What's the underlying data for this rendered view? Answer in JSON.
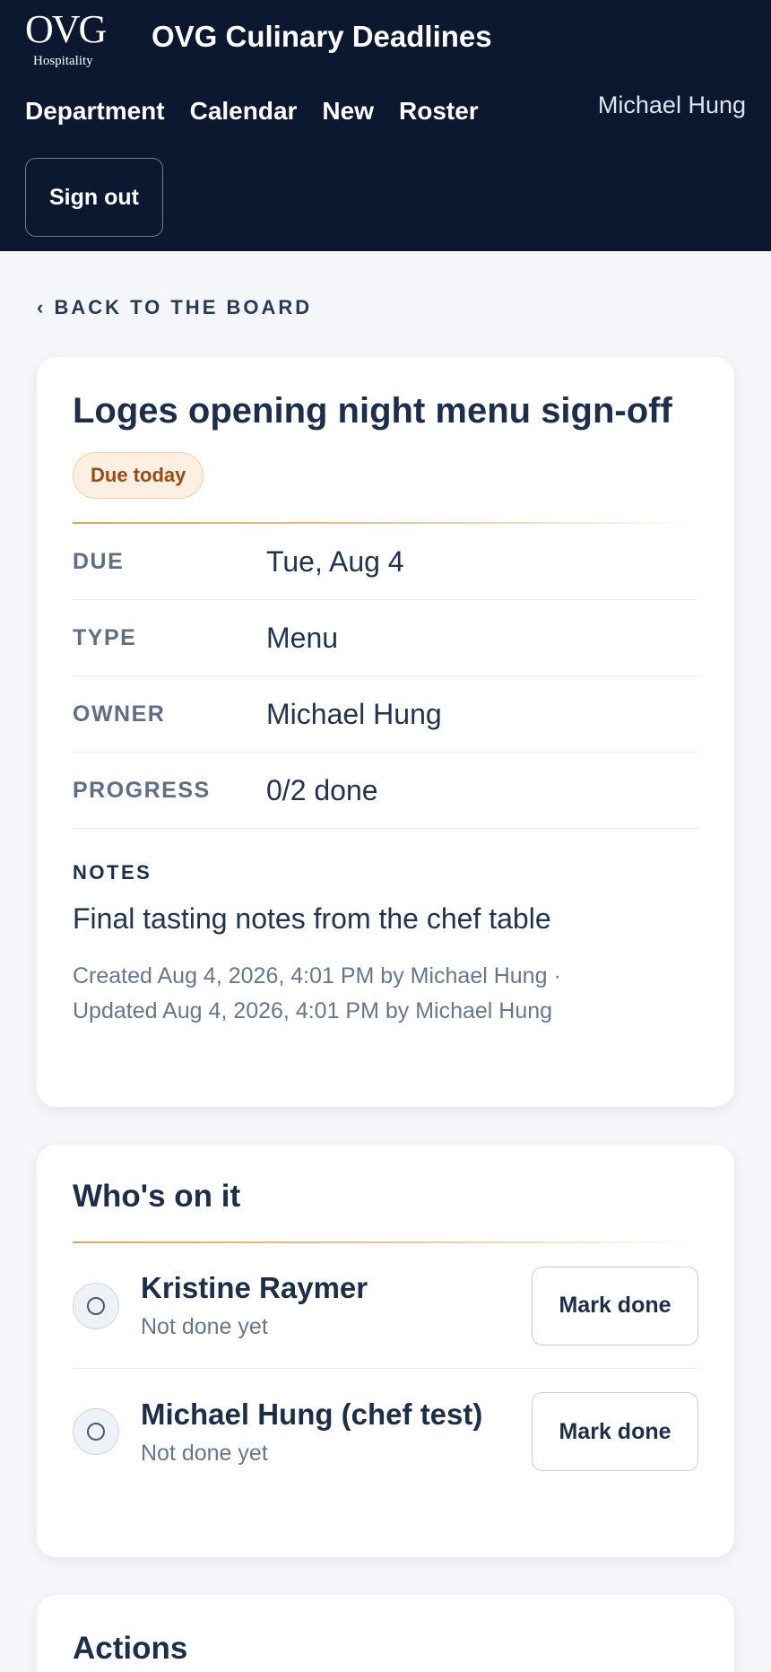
{
  "header": {
    "logo_text": "OVG",
    "logo_sub": "Hospitality",
    "app_title": "OVG Culinary Deadlines",
    "nav": [
      "Department",
      "Calendar",
      "New",
      "Roster"
    ],
    "user_name": "Michael Hung",
    "sign_out_label": "Sign out"
  },
  "back_link": "‹ BACK TO THE BOARD",
  "task": {
    "title": "Loges opening night menu sign-off",
    "badge": "Due today",
    "badge_colors": {
      "bg": "#fdf0e2",
      "border": "#f0cfa8",
      "text": "#9a4a12"
    },
    "meta": [
      {
        "label": "DUE",
        "value": "Tue, Aug 4"
      },
      {
        "label": "TYPE",
        "value": "Menu"
      },
      {
        "label": "OWNER",
        "value": "Michael Hung"
      },
      {
        "label": "PROGRESS",
        "value": "0/2 done"
      }
    ],
    "progress": {
      "done": 0,
      "total": 2
    },
    "notes_label": "NOTES",
    "notes": "Final tasting notes from the chef table",
    "created_line": "Created Aug 4, 2026, 4:01 PM by Michael Hung ·",
    "updated_line": "Updated Aug 4, 2026, 4:01 PM by Michael Hung"
  },
  "assignees_section": {
    "title": "Who's on it",
    "items": [
      {
        "name": "Kristine Raymer",
        "status": "Not done yet",
        "action": "Mark done",
        "icon": "circle-icon"
      },
      {
        "name": "Michael Hung (chef test)",
        "status": "Not done yet",
        "action": "Mark done",
        "icon": "circle-icon"
      }
    ]
  },
  "actions_section": {
    "title": "Actions"
  },
  "colors": {
    "header_bg": "#0b1830",
    "page_bg": "#f4f6f9",
    "accent_gold": "#d9a95c",
    "heading": "#1c2e4a"
  }
}
